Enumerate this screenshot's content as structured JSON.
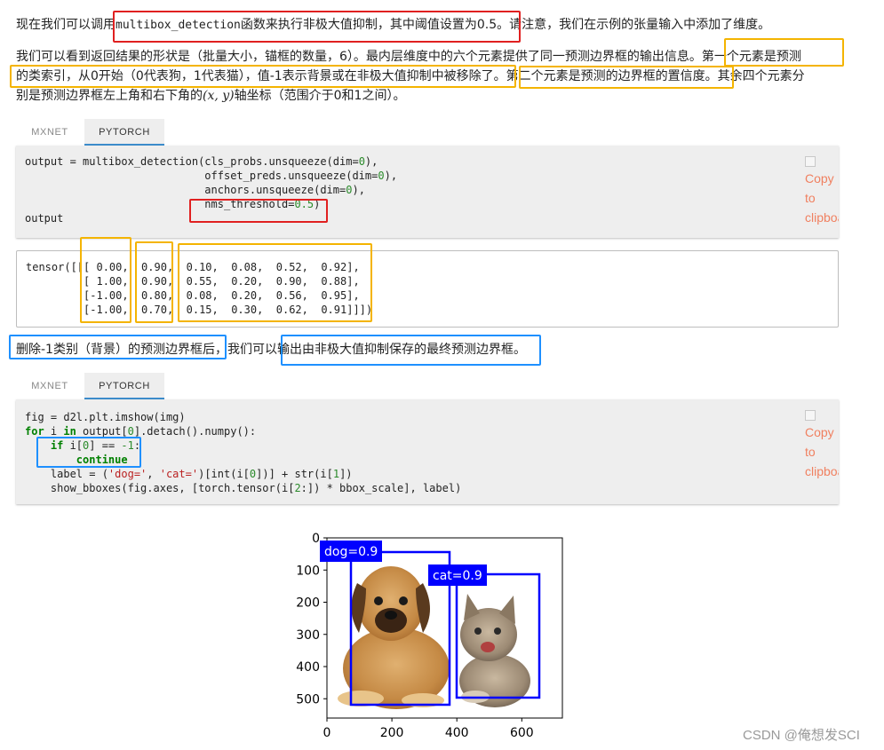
{
  "para1": {
    "before": "现在我们可以调用",
    "code": "multibox_detection",
    "after": "函数来执行非极大值抑制，其中阈值设置为0.5。请注意，我们在示例的张量输入中添加了维度。"
  },
  "para2": {
    "line1": "我们可以看到返回结果的形状是（批量大小，锚框的数量，6）。最内层维度中的六个元素提供了同一预测边界框的输出信息。第一个元素是预测",
    "line2": "的类索引，从0开始（0代表狗，1代表猫），值-1表示背景或在非极大值抑制中被移除了。第二个元素是预测的边界框的置信度。其余四个元素分",
    "line3_before": "别是预测边界框左上角和右下角的",
    "line3_math": "(x, y)",
    "line3_after": "轴坐标（范围介于0和1之间）。"
  },
  "tabs1": {
    "tab1": "MXNET",
    "tab2": "PYTORCH"
  },
  "code1": {
    "l1a": "output = multibox_detection(cls_probs.unsqueeze(dim=",
    "l1n": "0",
    "l1b": "),",
    "l2a": "                            offset_preds.unsqueeze(dim=",
    "l2n": "0",
    "l2b": "),",
    "l3a": "                            anchors.unsqueeze(dim=",
    "l3n": "0",
    "l3b": "),",
    "l4a": "                            nms_threshold=",
    "l4n": "0.5",
    "l4b": ")",
    "l5": "output"
  },
  "copy_label": "Copy to clipboard",
  "output1": {
    "l1": "tensor([[[ 0.00,  0.90,  0.10,  0.08,  0.52,  0.92],",
    "l2": "         [ 1.00,  0.90,  0.55,  0.20,  0.90,  0.88],",
    "l3": "         [-1.00,  0.80,  0.08,  0.20,  0.56,  0.95],",
    "l4": "         [-1.00,  0.70,  0.15,  0.30,  0.62,  0.91]]])"
  },
  "para3": "删除-1类别（背景）的预测边界框后，我们可以输出由非极大值抑制保存的最终预测边界框。",
  "tabs2": {
    "tab1": "MXNET",
    "tab2": "PYTORCH"
  },
  "code2": {
    "l1": "fig = d2l.plt.imshow(img)",
    "l2_kw1": "for",
    "l2_a": " i ",
    "l2_kw2": "in",
    "l2_b": " output[",
    "l2_n": "0",
    "l2_c": "].detach().numpy():",
    "l3_kw": "if",
    "l3_a": " i[",
    "l3_n0": "0",
    "l3_b": "] == ",
    "l3_n1": "-1",
    "l3_c": ":",
    "l4_kw": "continue",
    "l5_a": "    label = (",
    "l5_s1": "'dog='",
    "l5_b": ", ",
    "l5_s2": "'cat='",
    "l5_c": ")[int(i[",
    "l5_n": "0",
    "l5_d": "])] + str(i[",
    "l5_n2": "1",
    "l5_e": "])",
    "l6_a": "    show_bboxes(fig.axes, [torch.tensor(i[",
    "l6_n": "2",
    "l6_b": ":]) * bbox_scale], label)"
  },
  "plot": {
    "y_ticks": [
      "0",
      "100",
      "200",
      "300",
      "400",
      "500"
    ],
    "x_ticks": [
      "0",
      "200",
      "400",
      "600"
    ],
    "boxes": [
      {
        "label": "dog=0.9",
        "color": "#0000ff"
      },
      {
        "label": "cat=0.9",
        "color": "#0000ff"
      }
    ]
  },
  "watermark": "CSDN @俺想发SCI",
  "colors": {
    "tab_underline": "#3c8dcc",
    "highlight_red": "#e02020",
    "highlight_yellow": "#f4b400",
    "highlight_blue": "#1e90ff",
    "copy_link": "#f08060"
  }
}
